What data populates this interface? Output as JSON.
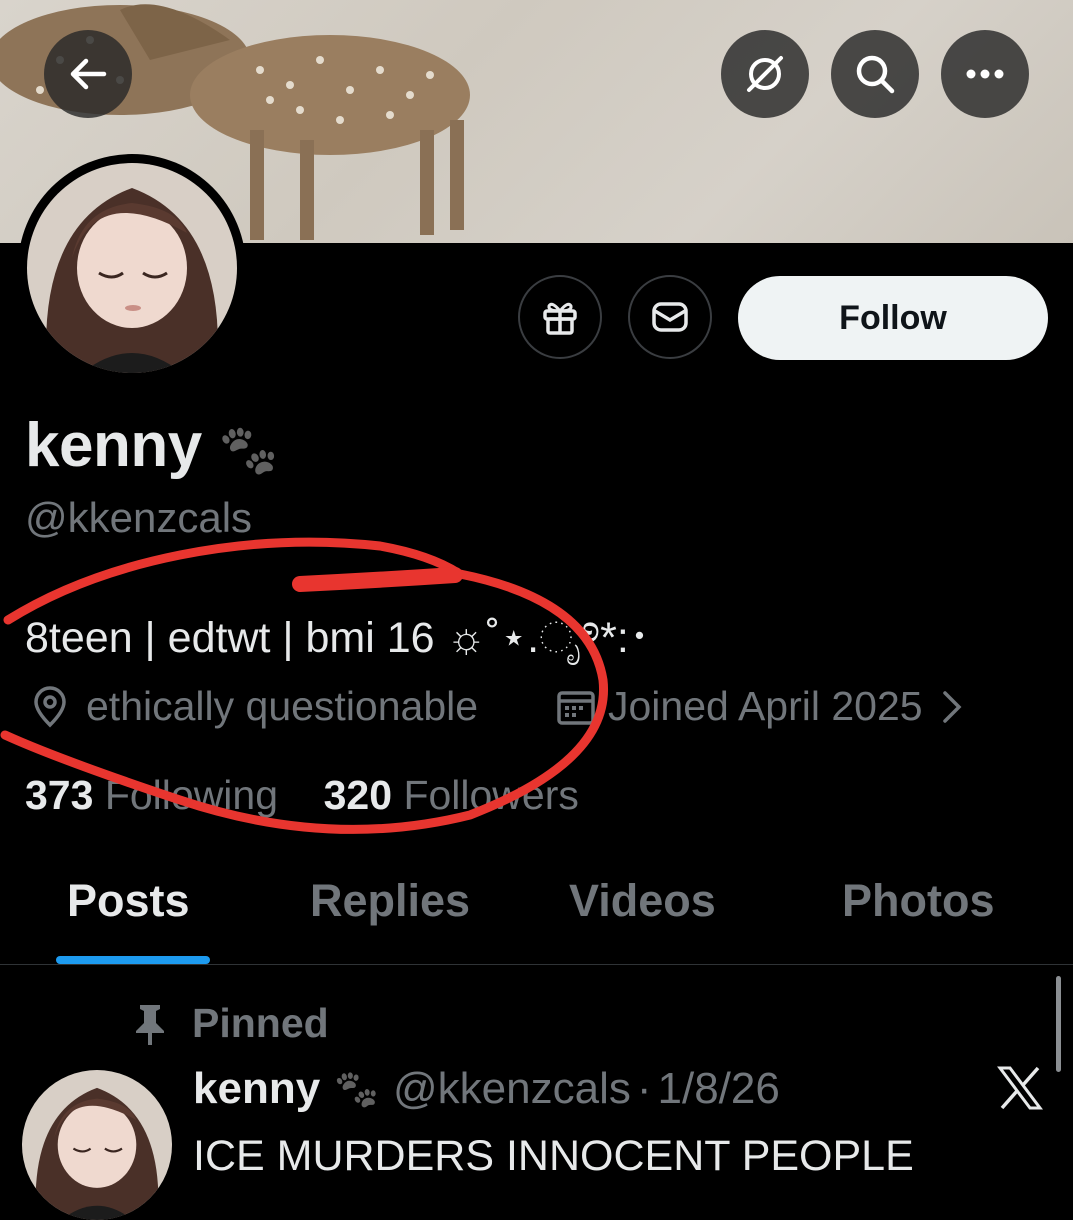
{
  "header": {
    "back_icon": "arrow-left-icon",
    "actions": [
      "grok-icon",
      "search-icon",
      "more-icon"
    ]
  },
  "profile": {
    "name": "kenny",
    "name_emoji": "🐾",
    "handle": "@kkenzcals",
    "bio": "8teen | edtwt | bmi 16 ☼˚⋆.ೃ࿔*:･",
    "location": "ethically questionable",
    "joined": "Joined April 2025",
    "following_count": "373",
    "following_label": "Following",
    "followers_count": "320",
    "followers_label": "Followers"
  },
  "buttons": {
    "gift_icon": "gift-icon",
    "message_icon": "mail-icon",
    "follow_label": "Follow"
  },
  "tabs": [
    {
      "label": "Posts",
      "active": true
    },
    {
      "label": "Replies",
      "active": false
    },
    {
      "label": "Videos",
      "active": false
    },
    {
      "label": "Photos",
      "active": false
    }
  ],
  "pinned_post": {
    "pinned_label": "Pinned",
    "author": "kenny",
    "author_emoji": "🐾",
    "handle": "@kkenzcals",
    "separator": "·",
    "date": "1/8/26",
    "text": "ICE MURDERS INNOCENT PEOPLE"
  },
  "colors": {
    "background": "#000000",
    "primary_text": "#e7e9ea",
    "secondary_text": "#71767b",
    "accent": "#1d9bf0",
    "annotation": "#e8352f"
  }
}
